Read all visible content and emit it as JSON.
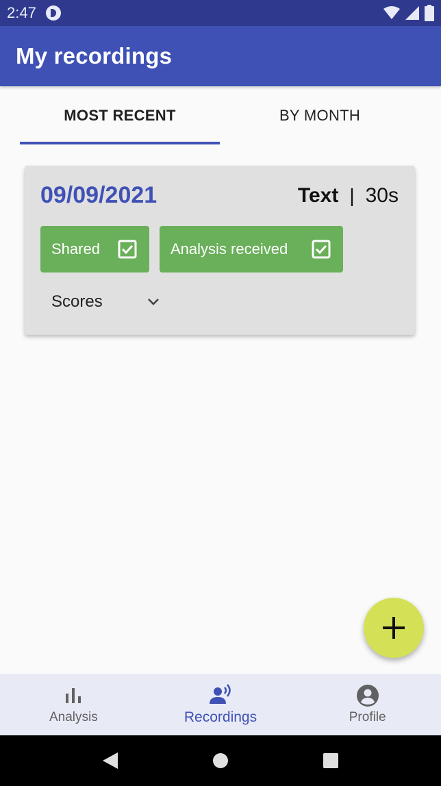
{
  "status_bar": {
    "time": "2:47"
  },
  "app_bar": {
    "title": "My recordings"
  },
  "tabs": [
    {
      "label": "MOST RECENT",
      "active": true
    },
    {
      "label": "BY MONTH",
      "active": false
    }
  ],
  "recordings": [
    {
      "date": "09/09/2021",
      "type": "Text",
      "separator": "|",
      "duration": "30s",
      "badges": [
        {
          "label": "Shared",
          "checked": true
        },
        {
          "label": "Analysis received",
          "checked": true
        }
      ],
      "scores_label": "Scores"
    }
  ],
  "fab": {
    "icon": "add-icon"
  },
  "bottom_nav": {
    "items": [
      {
        "label": "Analysis",
        "icon": "bar-chart-icon",
        "active": false
      },
      {
        "label": "Recordings",
        "icon": "record-voice-icon",
        "active": true
      },
      {
        "label": "Profile",
        "icon": "account-circle-icon",
        "active": false
      }
    ]
  },
  "colors": {
    "primary": "#3f51b5",
    "primary_dark": "#2f3a8f",
    "badge_green": "#6aaf5a",
    "fab_accent": "#d4e157",
    "card_bg": "#e0e0e0",
    "nav_bg": "#e8eaf6"
  }
}
